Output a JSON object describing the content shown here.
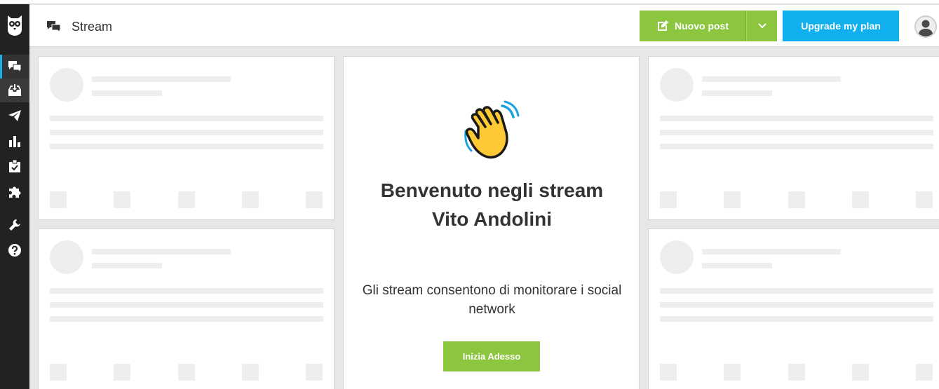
{
  "header": {
    "title": "Stream",
    "new_post_label": "Nuovo post",
    "upgrade_label": "Upgrade my plan"
  },
  "sidebar": {
    "items": [
      {
        "icon": "streams-icon",
        "active": true
      },
      {
        "icon": "inbox-icon"
      },
      {
        "icon": "publisher-icon"
      },
      {
        "icon": "analytics-icon"
      },
      {
        "icon": "assignments-icon"
      },
      {
        "icon": "apps-icon"
      },
      {
        "icon": "tools-icon"
      },
      {
        "icon": "help-icon"
      }
    ]
  },
  "welcome": {
    "title_line1": "Benvenuto negli stream",
    "title_line2": "Vito Andolini",
    "description": "Gli stream consentono di monitorare i social network",
    "start_label": "Inizia Adesso"
  },
  "colors": {
    "primary_green": "#8cc63f",
    "upgrade_blue": "#10b0ef",
    "sidebar_bg": "#222222",
    "active_indicator": "#1bb0e8"
  }
}
